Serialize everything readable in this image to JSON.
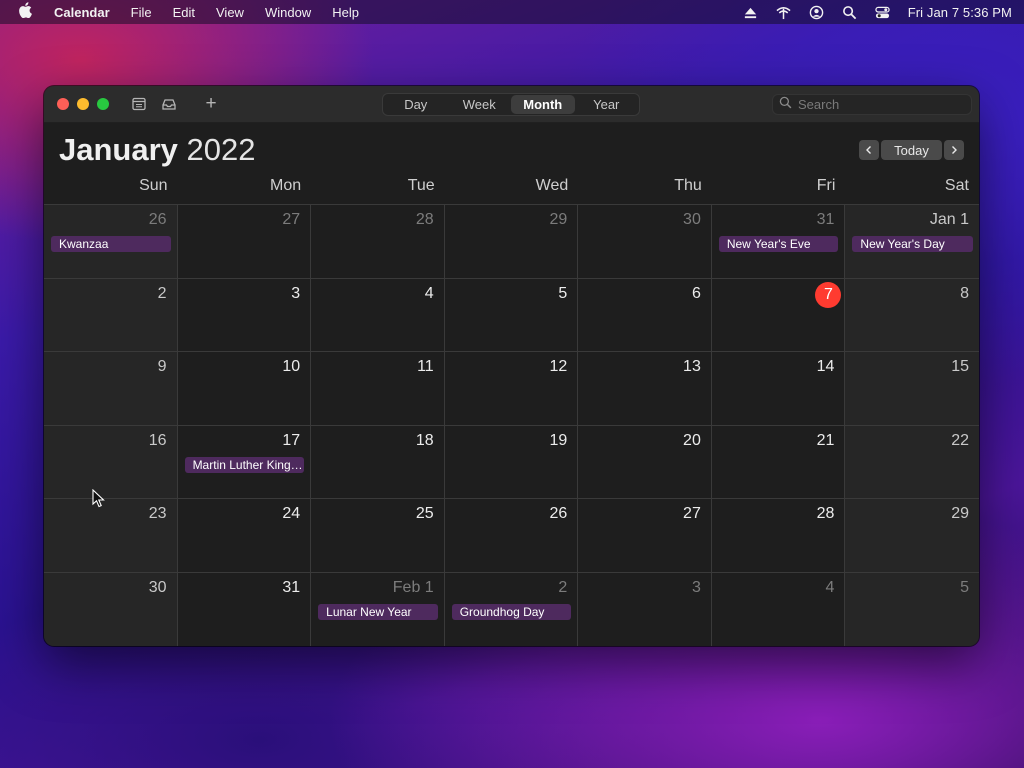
{
  "menubar": {
    "apple_icon": "apple-icon",
    "app_name": "Calendar",
    "items": [
      "File",
      "Edit",
      "View",
      "Window",
      "Help"
    ],
    "status_icons": [
      "eject-icon",
      "wifi-icon",
      "user-account-icon",
      "spotlight-search-icon",
      "control-center-icon"
    ],
    "clock": "Fri Jan 7  5:36 PM"
  },
  "toolbar": {
    "icons": [
      "calendar-list-icon",
      "inbox-icon",
      "add-event-icon"
    ],
    "add_symbol": "+",
    "view_tabs": [
      {
        "label": "Day",
        "active": false
      },
      {
        "label": "Week",
        "active": false
      },
      {
        "label": "Month",
        "active": true
      },
      {
        "label": "Year",
        "active": false
      }
    ],
    "search_placeholder": "Search"
  },
  "header": {
    "month": "January",
    "year": "2022",
    "today_label": "Today"
  },
  "weekdays": [
    "Sun",
    "Mon",
    "Tue",
    "Wed",
    "Thu",
    "Fri",
    "Sat"
  ],
  "colors": {
    "today_circle": "#ff3b30",
    "event_bg": "#4e2a5e",
    "close": "#fe5f57",
    "minimize": "#febc2e",
    "zoom": "#28c840"
  },
  "days": [
    {
      "label": "26",
      "other": true,
      "events": [
        "Kwanzaa"
      ]
    },
    {
      "label": "27",
      "other": true,
      "events": []
    },
    {
      "label": "28",
      "other": true,
      "events": []
    },
    {
      "label": "29",
      "other": true,
      "events": []
    },
    {
      "label": "30",
      "other": true,
      "events": []
    },
    {
      "label": "31",
      "other": true,
      "events": [
        "New Year's Eve"
      ]
    },
    {
      "label": "Jan 1",
      "other": false,
      "events": [
        "New Year's Day"
      ]
    },
    {
      "label": "2",
      "other": false,
      "events": []
    },
    {
      "label": "3",
      "other": false,
      "events": []
    },
    {
      "label": "4",
      "other": false,
      "events": []
    },
    {
      "label": "5",
      "other": false,
      "events": []
    },
    {
      "label": "6",
      "other": false,
      "events": []
    },
    {
      "label": "7",
      "other": false,
      "today": true,
      "events": []
    },
    {
      "label": "8",
      "other": false,
      "events": []
    },
    {
      "label": "9",
      "other": false,
      "events": []
    },
    {
      "label": "10",
      "other": false,
      "events": []
    },
    {
      "label": "11",
      "other": false,
      "events": []
    },
    {
      "label": "12",
      "other": false,
      "events": []
    },
    {
      "label": "13",
      "other": false,
      "events": []
    },
    {
      "label": "14",
      "other": false,
      "events": []
    },
    {
      "label": "15",
      "other": false,
      "events": []
    },
    {
      "label": "16",
      "other": false,
      "events": []
    },
    {
      "label": "17",
      "other": false,
      "events": [
        "Martin Luther King Jr. Day"
      ]
    },
    {
      "label": "18",
      "other": false,
      "events": []
    },
    {
      "label": "19",
      "other": false,
      "events": []
    },
    {
      "label": "20",
      "other": false,
      "events": []
    },
    {
      "label": "21",
      "other": false,
      "events": []
    },
    {
      "label": "22",
      "other": false,
      "events": []
    },
    {
      "label": "23",
      "other": false,
      "events": []
    },
    {
      "label": "24",
      "other": false,
      "events": []
    },
    {
      "label": "25",
      "other": false,
      "events": []
    },
    {
      "label": "26",
      "other": false,
      "events": []
    },
    {
      "label": "27",
      "other": false,
      "events": []
    },
    {
      "label": "28",
      "other": false,
      "events": []
    },
    {
      "label": "29",
      "other": false,
      "events": []
    },
    {
      "label": "30",
      "other": false,
      "events": []
    },
    {
      "label": "31",
      "other": false,
      "events": []
    },
    {
      "label": "Feb 1",
      "other": true,
      "events": [
        "Lunar New Year"
      ]
    },
    {
      "label": "2",
      "other": true,
      "events": [
        "Groundhog Day"
      ]
    },
    {
      "label": "3",
      "other": true,
      "events": []
    },
    {
      "label": "4",
      "other": true,
      "events": []
    },
    {
      "label": "5",
      "other": true,
      "events": []
    }
  ]
}
